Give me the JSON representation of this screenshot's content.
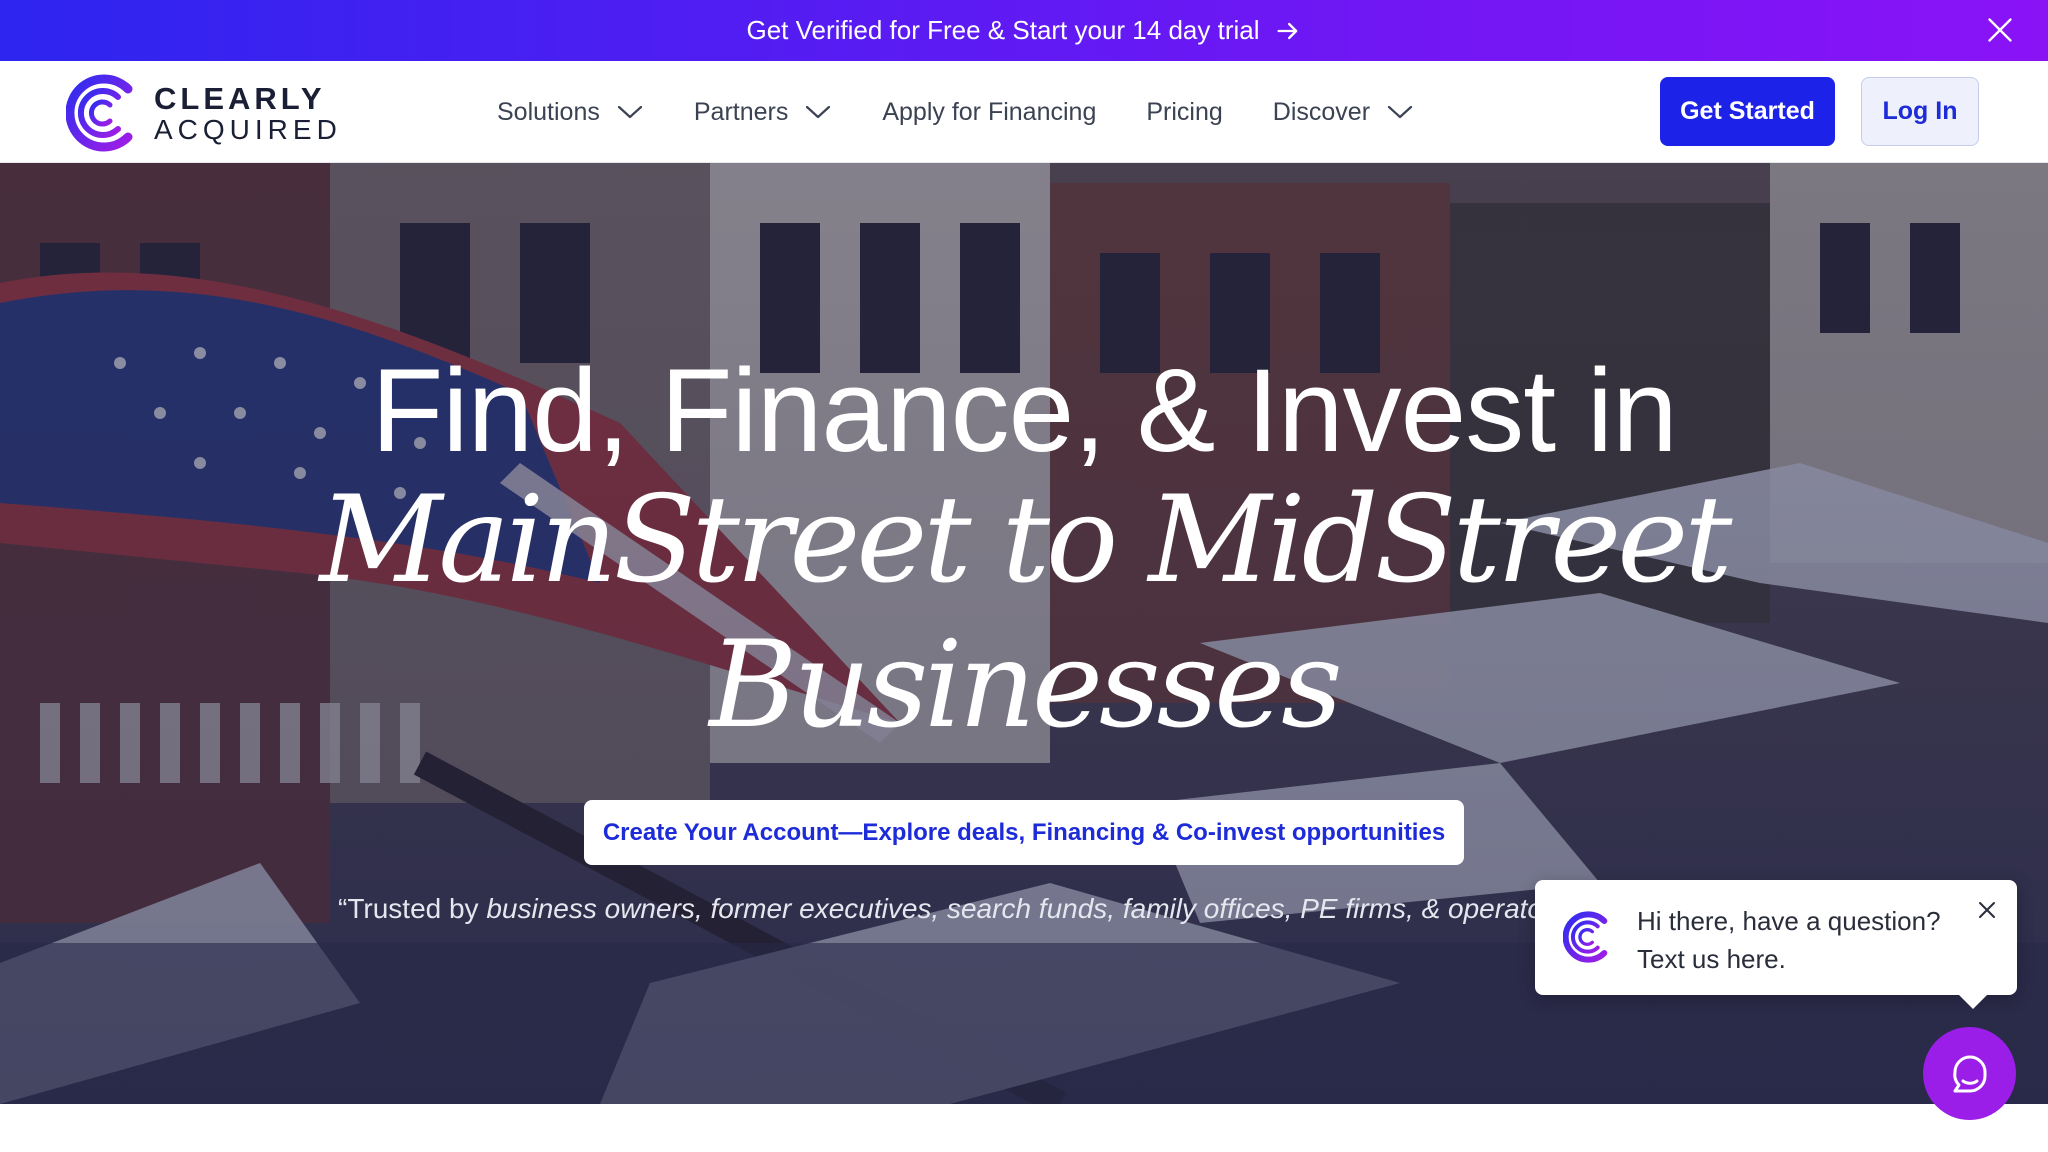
{
  "promo": {
    "text": "Get Verified for Free & Start your 14 day trial",
    "arrow_icon": "arrow-right-icon",
    "close_icon": "close-icon"
  },
  "header": {
    "logo_top": "CLEARLY",
    "logo_bottom": "ACQUIRED",
    "nav": [
      {
        "label": "Solutions",
        "has_dropdown": true
      },
      {
        "label": "Partners",
        "has_dropdown": true
      },
      {
        "label": "Apply for Financing",
        "has_dropdown": false
      },
      {
        "label": "Pricing",
        "has_dropdown": false
      },
      {
        "label": "Discover",
        "has_dropdown": true
      }
    ],
    "get_started_label": "Get Started",
    "login_label": "Log In"
  },
  "hero": {
    "headline_line1": "Find, Finance, & Invest in",
    "headline_line2": "MainStreet to MidStreet",
    "headline_line3": "Businesses",
    "cta_label": "Create Your Account—Explore deals, Financing & Co-invest opportunities",
    "trust_prefix": "“Trusted by ",
    "trust_italic": "business owners, former executives, search funds, family offices, PE firms, & operators"
  },
  "chat": {
    "line1": "Hi there, have a question?",
    "line2": "Text us here.",
    "close_icon": "close-icon",
    "launcher_icon": "chat-bubble-icon"
  },
  "colors": {
    "brand_blue": "#1d22e8",
    "brand_purple": "#9a1ee8",
    "promo_gradient_start": "#2d25f0",
    "promo_gradient_end": "#8a13f6"
  }
}
